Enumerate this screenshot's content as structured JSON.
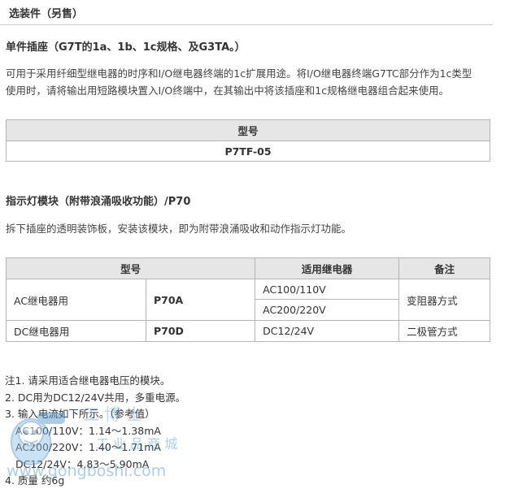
{
  "section": {
    "title": "选装件（另售）"
  },
  "socket": {
    "heading": "单件插座（G7T的1a、1b、1c规格、及G3TA。）",
    "desc_line1": "可用于采用纤细型继电器的时序和I/O继电器终端的1c扩展用途。将I/O继电器终端G7TC部分作为1c类型",
    "desc_line2": "使用时，请将输出用短路模块置入I/O终端中，在其输出中将该插座和1c规格继电器组合起来使用。",
    "table": {
      "header": "型号",
      "value": "P7TF-05"
    }
  },
  "indicator": {
    "heading": "指示灯模块（附带浪涌吸收功能）/P70",
    "desc": "拆下插座的透明装饰板，安装该模块，即为附带浪涌吸收和动作指示灯功能。",
    "table": {
      "headers": [
        "型号",
        "适用继电器",
        "备注"
      ],
      "rows": [
        {
          "use": "AC继电器用",
          "model": "P70A",
          "relays": [
            "AC100/110V",
            "AC200/220V"
          ],
          "note": "变阻器方式"
        },
        {
          "use": "DC继电器用",
          "model": "P70D",
          "relays": [
            "DC12/24V"
          ],
          "note": "二极管方式"
        }
      ]
    }
  },
  "notes": {
    "n1": "注1. 请采用适合继电器电压的模块。",
    "n2": "2. DC用为DC12/24V共用，多重电源。",
    "n3": "3. 输入电流如下所示。（参考值）",
    "n3a": "AC100/110V：1.14～1.38mA",
    "n3b": "AC200/220V：1.40～1.71mA",
    "n3c": "DC12/24V：4.83～5.90mA",
    "n4": "4. 质量 约6g"
  },
  "watermark": {
    "text_cn": "工 业 品 商 城",
    "text_url": "www.gongboshi.com",
    "text_brand": "工 博 士",
    "color": "#4a90c8"
  }
}
